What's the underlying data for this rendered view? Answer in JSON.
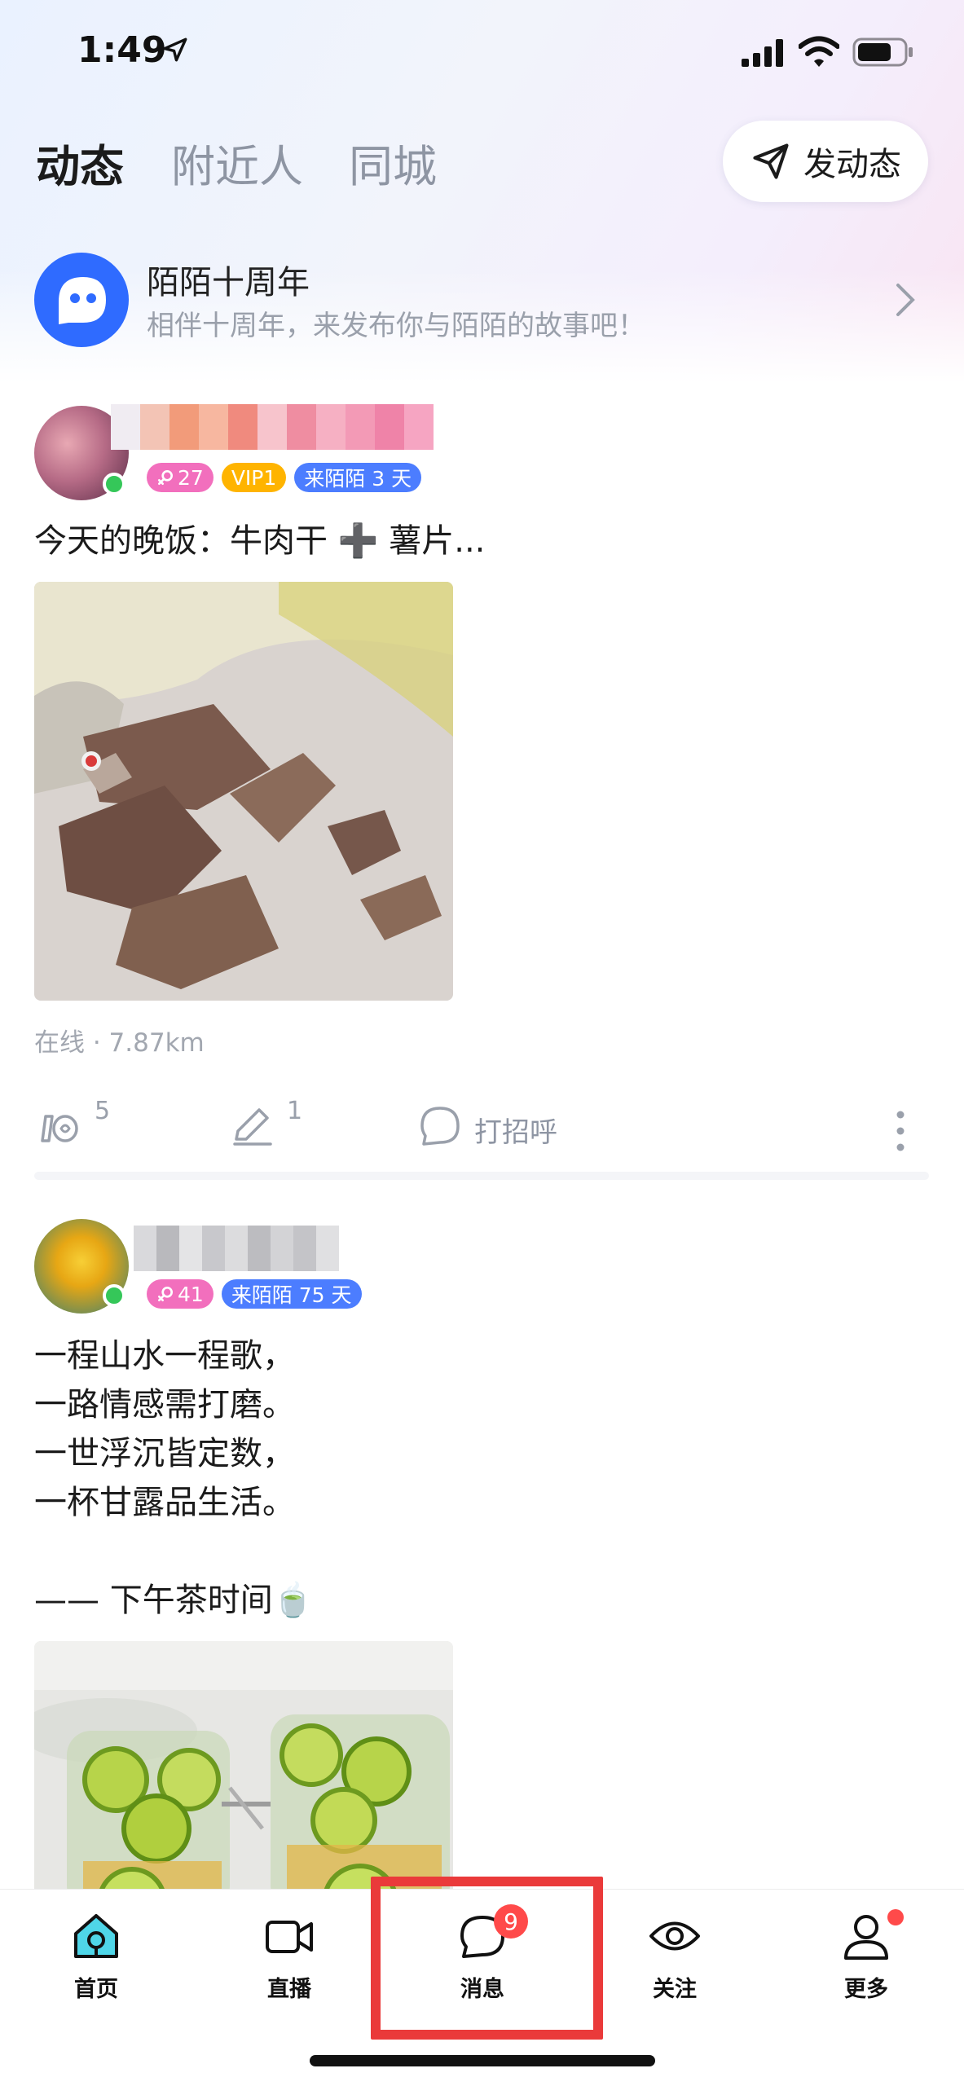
{
  "status_bar": {
    "time": "1:49"
  },
  "header": {
    "tabs": [
      {
        "label": "动态",
        "active": true
      },
      {
        "label": "附近人",
        "active": false
      },
      {
        "label": "同城",
        "active": false
      }
    ],
    "post_button_label": "发动态"
  },
  "banner": {
    "title": "陌陌十周年",
    "subtitle": "相伴十周年，来发布你与陌陌的故事吧！"
  },
  "posts": [
    {
      "badges": {
        "age": "27",
        "vip": "VIP1",
        "days": "来陌陌 3 天"
      },
      "text": "今天的晚饭：牛肉干 ➕ 薯片...",
      "meta": "在线 · 7.87km",
      "actions": {
        "like_count": "5",
        "comment_count": "1",
        "greet_label": "打招呼"
      }
    },
    {
      "badges": {
        "age": "41",
        "days": "来陌陌 75 天"
      },
      "text": "一程山水一程歌，\n一路情感需打磨。\n一世浮沉皆定数，\n一杯甘露品生活。\n\n—— 下午茶时间🍵"
    }
  ],
  "tabbar": {
    "items": [
      {
        "label": "首页",
        "icon": "home-icon",
        "active": true
      },
      {
        "label": "直播",
        "icon": "video-camera-icon"
      },
      {
        "label": "消息",
        "icon": "chat-bubble-icon",
        "badge": "9"
      },
      {
        "label": "关注",
        "icon": "eye-icon"
      },
      {
        "label": "更多",
        "icon": "person-icon",
        "dot": true
      }
    ]
  },
  "colors": {
    "brand_blue": "#2f6bff",
    "active_accent": "#4fd6e8",
    "badge_red": "#ff4a4a",
    "highlight_red": "#ea3a3a"
  }
}
